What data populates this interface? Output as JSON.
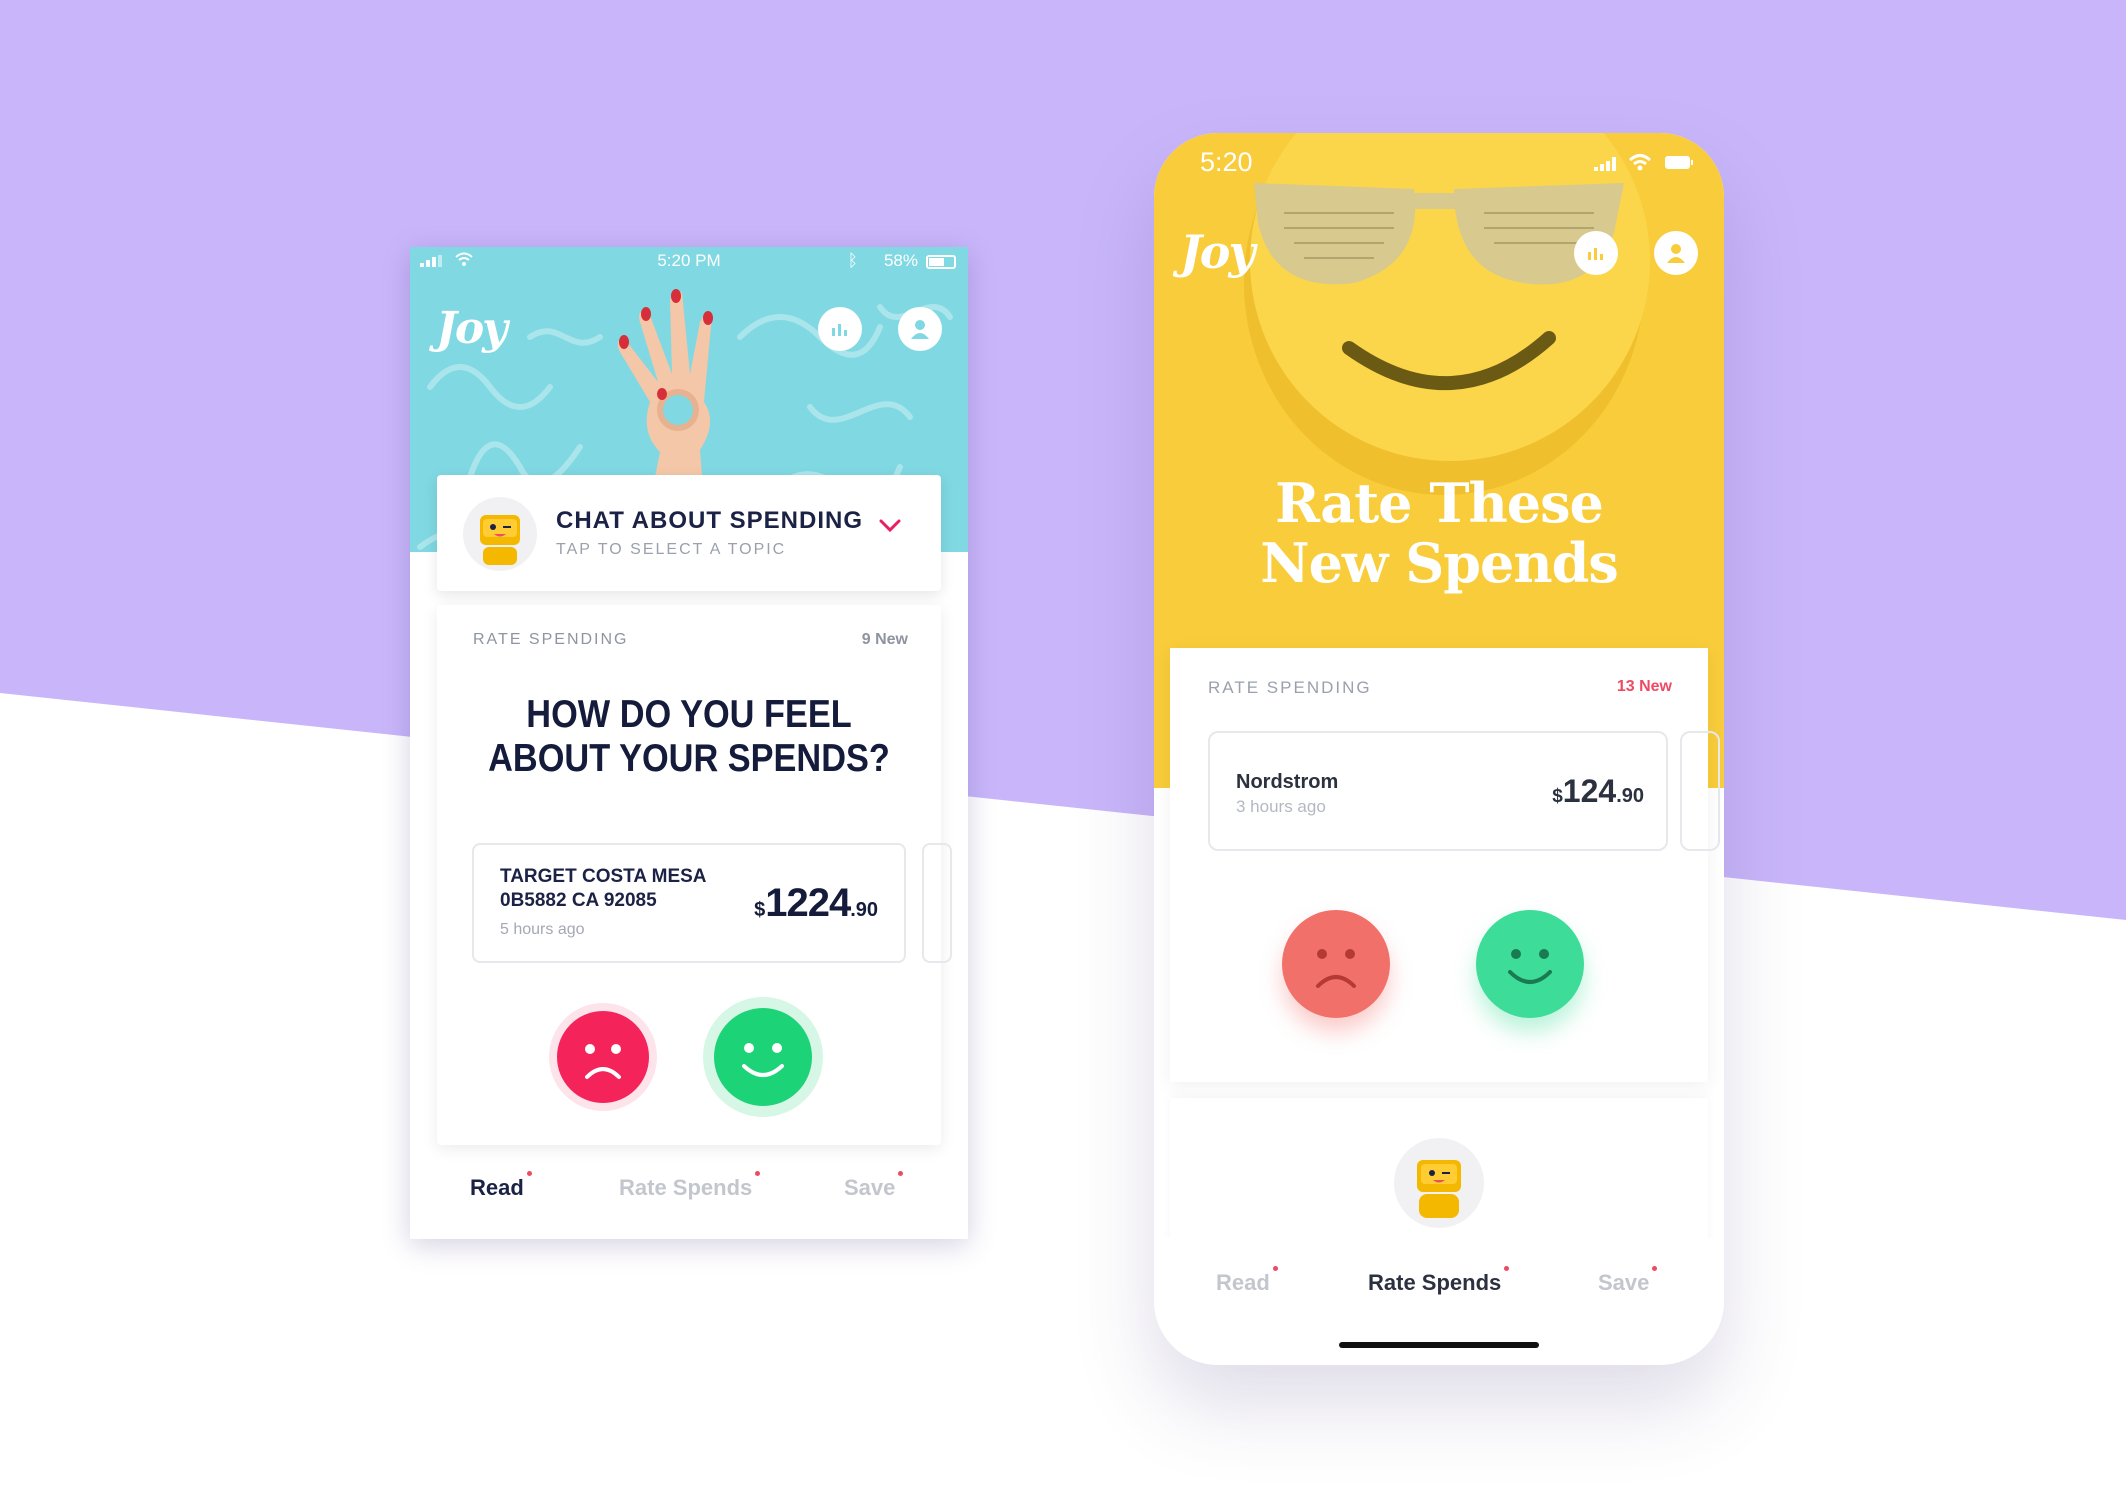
{
  "colors": {
    "background_purple": "#c9b6fa",
    "left_header_teal": "#7fd8e2",
    "right_header_yellow": "#f8cc3a",
    "navy_text": "#1b2245",
    "sad_red": "#f4245a",
    "happy_green": "#1dd377",
    "sad_coral": "#f2706a",
    "happy_mint": "#3ddc98",
    "badge_red": "#ee4a63",
    "chevron_pink": "#e91e63"
  },
  "left_phone": {
    "status": {
      "time": "5:20 PM",
      "battery": "58%",
      "icons": [
        "signal-icon",
        "wifi-icon",
        "bluetooth-icon",
        "battery-icon"
      ]
    },
    "logo": "Joy",
    "header_icons": [
      "stats-icon",
      "profile-icon"
    ],
    "chat": {
      "title": "CHAT ABOUT SPENDING",
      "subtitle": "TAP TO SELECT A TOPIC"
    },
    "rate_card": {
      "section_label": "RATE SPENDING",
      "new_count": "9 New",
      "question_line1": "HOW DO YOU FEEL",
      "question_line2": "ABOUT YOUR SPENDS?",
      "spend": {
        "merchant_line1": "TARGET COSTA MESA",
        "merchant_line2": "0B5882 CA 92085",
        "time_ago": "5 hours ago",
        "currency": "$",
        "amount_whole": "1224",
        "amount_cents": ".90"
      }
    },
    "tabs": [
      {
        "label": "Read",
        "active": true
      },
      {
        "label": "Rate Spends",
        "active": false
      },
      {
        "label": "Save",
        "active": false
      }
    ]
  },
  "right_phone": {
    "status": {
      "time": "5:20",
      "icons": [
        "signal-icon",
        "wifi-icon",
        "battery-icon"
      ]
    },
    "logo": "Joy",
    "header_icons": [
      "stats-icon",
      "profile-icon"
    ],
    "title_line1": "Rate These",
    "title_line2": "New Spends",
    "rate_card": {
      "section_label": "RATE SPENDING",
      "new_count": "13 New",
      "spend": {
        "merchant": "Nordstrom",
        "time_ago": "3 hours ago",
        "currency": "$",
        "amount_whole": "124",
        "amount_cents": ".90"
      }
    },
    "tabs": [
      {
        "label": "Read",
        "active": false
      },
      {
        "label": "Rate Spends",
        "active": true
      },
      {
        "label": "Save",
        "active": false
      }
    ]
  }
}
